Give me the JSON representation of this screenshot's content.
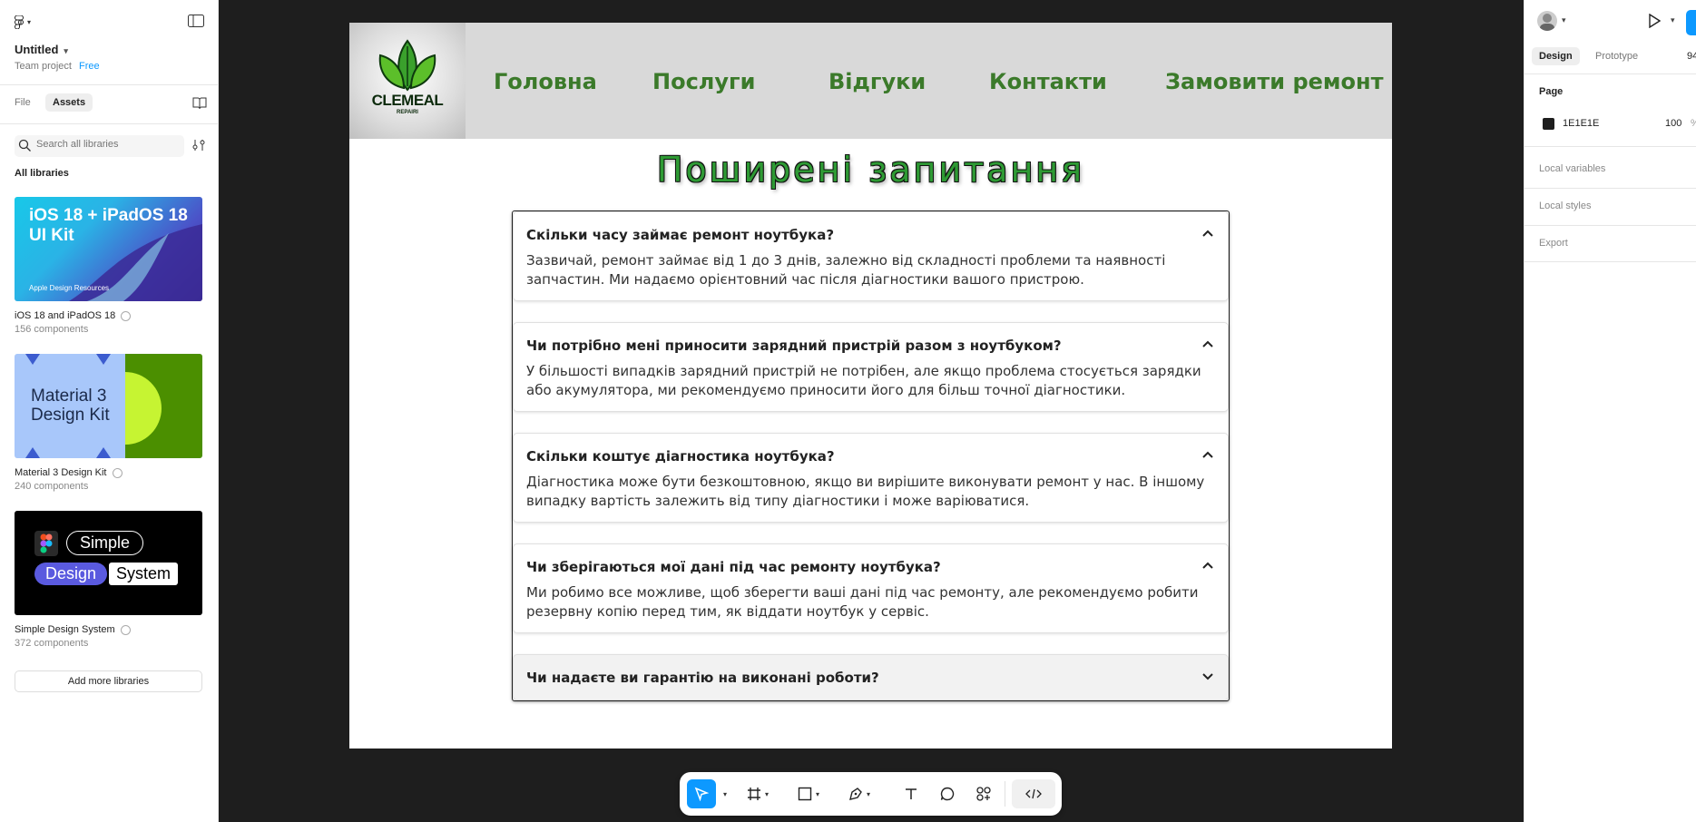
{
  "file": {
    "name": "Untitled",
    "team": "Team project",
    "plan": "Free"
  },
  "left_panel": {
    "tabs": [
      "File",
      "Assets"
    ],
    "search_placeholder": "Search all libraries",
    "section_title": "All libraries",
    "libraries": [
      {
        "name": "iOS 18 and iPadOS 18",
        "count": "156 components",
        "thumb_title": "iOS 18 + iPadOS 18 UI Kit",
        "thumb_sub": "Apple Design Resources"
      },
      {
        "name": "Material 3 Design Kit",
        "count": "240 components",
        "thumb_title": "Material 3 Design Kit"
      },
      {
        "name": "Simple Design System",
        "count": "372 components",
        "thumb_words": [
          "Simple",
          "Design",
          "System"
        ]
      }
    ],
    "add_button": "Add more libraries"
  },
  "right_panel": {
    "tabs": [
      "Design",
      "Prototype"
    ],
    "zoom": "94",
    "page_label": "Page",
    "page_color": "1E1E1E",
    "page_opacity": "100",
    "page_opacity_unit": "%",
    "sections": [
      "Local variables",
      "Local styles",
      "Export"
    ]
  },
  "canvas": {
    "logo_text": "CLEMEAL",
    "logo_sub": "REPAIRI",
    "nav": [
      "Головна",
      "Послуги",
      "Відгуки",
      "Контакти",
      "Замовити ремонт"
    ],
    "faq_title": "Поширені запитання",
    "faq": [
      {
        "q": "Скільки часу займає ремонт ноутбука?",
        "a": "Зазвичай, ремонт займає від 1 до 3 днів, залежно від складності проблеми та наявності запчастин. Ми надаємо орієнтовний час після діагностики вашого пристрою.",
        "expanded": true
      },
      {
        "q": "Чи потрібно мені приносити зарядний пристрій разом з ноутбуком?",
        "a": "У більшості випадків зарядний пристрій не потрібен, але якщо проблема стосується зарядки або акумулятора, ми рекомендуємо приносити його для більш точної діагностики.",
        "expanded": true
      },
      {
        "q": "Скільки коштує діагностика ноутбука?",
        "a": "Діагностика може бути безкоштовною, якщо ви вирішите виконувати ремонт у нас. В іншому випадку вартість залежить від типу діагностики і може варіюватися.",
        "expanded": true
      },
      {
        "q": "Чи зберігаються мої дані під час ремонту ноутбука?",
        "a": "Ми робимо все можливе, щоб зберегти ваші дані під час ремонту, але рекомендуємо робити резервну копію перед тим, як віддати ноутбук у сервіс.",
        "expanded": true
      },
      {
        "q": "Чи надаєте ви гарантію на виконані роботи?",
        "a": "",
        "expanded": false
      }
    ]
  },
  "colors": {
    "accent": "#0d99ff",
    "canvas_bg": "#1e1e1e",
    "nav_text": "#3b7a2a",
    "title_green": "#2e9a34"
  }
}
